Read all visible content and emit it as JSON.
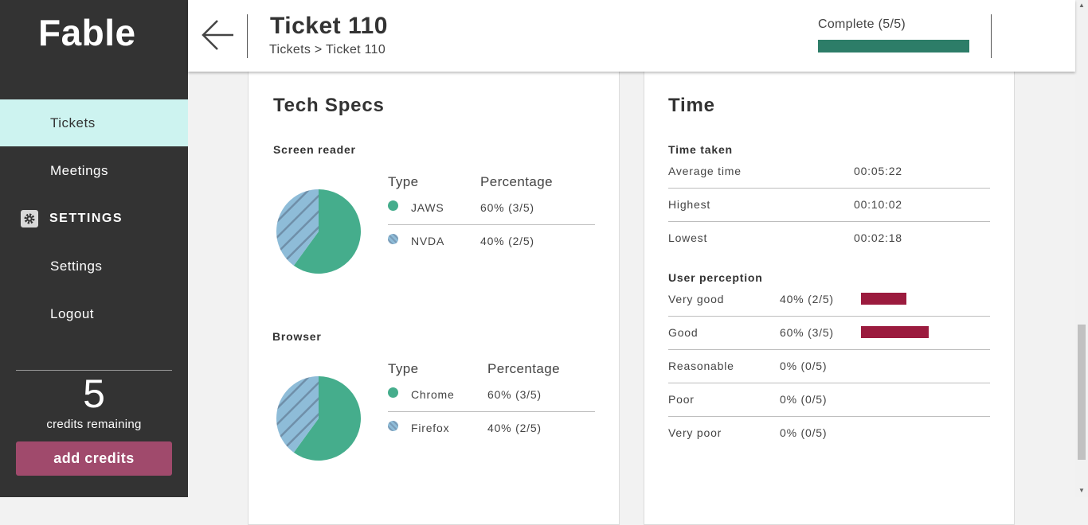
{
  "app": {
    "name": "Fable"
  },
  "sidebar": {
    "items": [
      {
        "label": "Tickets",
        "active": true
      },
      {
        "label": "Meetings",
        "active": false
      }
    ],
    "section_label": "SETTINGS",
    "section_items": [
      {
        "label": "Settings"
      },
      {
        "label": "Logout"
      }
    ],
    "credits": {
      "count": "5",
      "label": "credits remaining",
      "button": "add credits"
    }
  },
  "header": {
    "title": "Ticket 110",
    "breadcrumb": {
      "parent": "Tickets",
      "separator": " > ",
      "current": "Ticket 110"
    },
    "status": {
      "label": "Complete (5/5)",
      "progress": 1.0,
      "color": "#2d7d68"
    }
  },
  "tech_specs": {
    "title": "Tech Specs",
    "screen_reader": {
      "label": "Screen reader",
      "col_type": "Type",
      "col_pct": "Percentage",
      "rows": [
        {
          "type": "JAWS",
          "pct": "60% (3/5)",
          "value": 0.6,
          "color": "#45ad8c"
        },
        {
          "type": "NVDA",
          "pct": "40% (2/5)",
          "value": 0.4,
          "color": "#8ebcd8"
        }
      ]
    },
    "browser": {
      "label": "Browser",
      "col_type": "Type",
      "col_pct": "Percentage",
      "rows": [
        {
          "type": "Chrome",
          "pct": "60% (3/5)",
          "value": 0.6,
          "color": "#45ad8c"
        },
        {
          "type": "Firefox",
          "pct": "40% (2/5)",
          "value": 0.4,
          "color": "#8ebcd8"
        }
      ]
    }
  },
  "time": {
    "title": "Time",
    "time_taken": {
      "label": "Time taken",
      "rows": [
        {
          "label": "Average time",
          "value": "00:05:22"
        },
        {
          "label": "Highest",
          "value": "00:10:02"
        },
        {
          "label": "Lowest",
          "value": "00:02:18"
        }
      ]
    },
    "perception": {
      "label": "User perception",
      "bar_color": "#9b1b3e",
      "rows": [
        {
          "label": "Very good",
          "value": "40% (2/5)",
          "fraction": 0.4
        },
        {
          "label": "Good",
          "value": "60% (3/5)",
          "fraction": 0.6
        },
        {
          "label": "Reasonable",
          "value": "0% (0/5)",
          "fraction": 0
        },
        {
          "label": "Poor",
          "value": "0% (0/5)",
          "fraction": 0
        },
        {
          "label": "Very poor",
          "value": "0% (0/5)",
          "fraction": 0
        }
      ]
    }
  }
}
